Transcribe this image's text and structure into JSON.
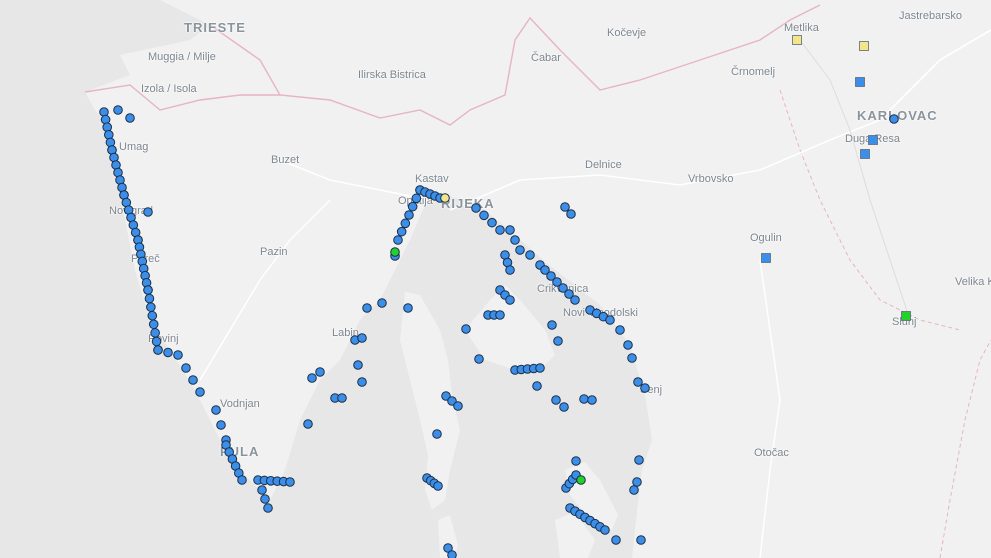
{
  "places": [
    {
      "name": "TRIESTE",
      "kind": "city"
    },
    {
      "name": "Muggia / Milje",
      "kind": "town"
    },
    {
      "name": "Izola / Isola",
      "kind": "town"
    },
    {
      "name": "Ilirska Bistrica",
      "kind": "town"
    },
    {
      "name": "Čabar",
      "kind": "town"
    },
    {
      "name": "Kočevje",
      "kind": "town"
    },
    {
      "name": "Metlika",
      "kind": "town"
    },
    {
      "name": "Jastrebarsko",
      "kind": "town"
    },
    {
      "name": "Črnomelj",
      "kind": "town"
    },
    {
      "name": "KARLOVAC",
      "kind": "city"
    },
    {
      "name": "Duga Resa",
      "kind": "town"
    },
    {
      "name": "Buzet",
      "kind": "town"
    },
    {
      "name": "Kastav",
      "kind": "town"
    },
    {
      "name": "Opatija",
      "kind": "town"
    },
    {
      "name": "RIJEKA",
      "kind": "city"
    },
    {
      "name": "Delnice",
      "kind": "town"
    },
    {
      "name": "Vrbovsko",
      "kind": "town"
    },
    {
      "name": "Umag",
      "kind": "town"
    },
    {
      "name": "Novigrad",
      "kind": "town"
    },
    {
      "name": "Poreč",
      "kind": "town"
    },
    {
      "name": "Pazin",
      "kind": "town"
    },
    {
      "name": "Ogulin",
      "kind": "town"
    },
    {
      "name": "Crikvenica",
      "kind": "town"
    },
    {
      "name": "Novi Vinodolski",
      "kind": "town"
    },
    {
      "name": "Labin",
      "kind": "town"
    },
    {
      "name": "Rovinj",
      "kind": "town"
    },
    {
      "name": "Slunj",
      "kind": "town"
    },
    {
      "name": "Velika Kladuša",
      "kind": "town"
    },
    {
      "name": "Vodnjan",
      "kind": "town"
    },
    {
      "name": "PULA",
      "kind": "city"
    },
    {
      "name": "Otočac",
      "kind": "town"
    },
    {
      "name": "Senj",
      "kind": "town"
    }
  ],
  "markers": {
    "colors": {
      "blue": "#3b8fe8",
      "green": "#23d12b",
      "yellow": "#f3e58a",
      "outline": "#1c2f4a"
    },
    "legend": [
      {
        "shape": "circle",
        "color": "blue"
      },
      {
        "shape": "circle",
        "color": "green"
      },
      {
        "shape": "circle",
        "color": "yellow"
      },
      {
        "shape": "square",
        "color": "blue"
      },
      {
        "shape": "square",
        "color": "green"
      },
      {
        "shape": "square",
        "color": "yellow"
      }
    ]
  },
  "colors": {
    "sea": "#d0d0d0",
    "land": "#f1f1f1",
    "border": "#e6b4c3",
    "road": "#ffffff"
  }
}
